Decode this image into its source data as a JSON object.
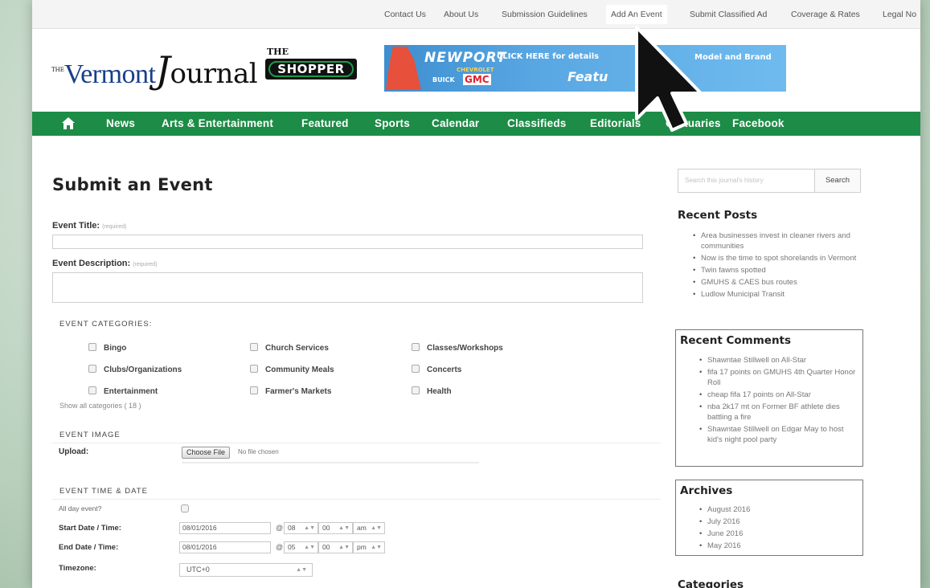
{
  "top_links": [
    "Contact Us",
    "About Us",
    "Submission Guidelines",
    "Add An Event",
    "Submit Classified Ad",
    "Coverage & Rates",
    "Legal No"
  ],
  "logo": {
    "the": "THE",
    "vermont": "Vermont",
    "journal_j": "J",
    "journal_rest": "ournal",
    "shopper_the": "THE",
    "shopper": "SHOPPER"
  },
  "banner": {
    "newport": "NEWPORT",
    "chevrolet": "CHEVROLET",
    "buick": "BUICK",
    "gmc": "GMC",
    "click": "CLICK HERE for details",
    "featured": "Featu",
    "right_text": "Model and Brand"
  },
  "nav": {
    "home_icon": "home-icon",
    "items": [
      "News",
      "Arts & Entertainment",
      "Featured",
      "Sports",
      "Calendar",
      "Classifieds",
      "Editorials",
      "Obituaries",
      "Facebook"
    ]
  },
  "form": {
    "title": "Submit an Event",
    "event_title_label": "Event Title:",
    "event_title_req": "(required)",
    "event_desc_label": "Event Description:",
    "event_desc_req": "(required)",
    "categories_heading": "EVENT CATEGORIES:",
    "categories": [
      "Bingo",
      "Church Services",
      "Classes/Workshops",
      "Clubs/Organizations",
      "Community Meals",
      "Concerts",
      "Entertainment",
      "Farmer's Markets",
      "Health"
    ],
    "show_all": "Show all categories ( 18 )",
    "image_heading": "EVENT IMAGE",
    "upload_label": "Upload:",
    "choose_file": "Choose File",
    "no_file": "No file chosen",
    "time_heading": "EVENT TIME & DATE",
    "all_day_label": "All day event?",
    "start_label": "Start Date / Time:",
    "start_date": "08/01/2016",
    "start_hour": "08",
    "start_min": "00",
    "start_ampm": "am",
    "end_label": "End Date / Time:",
    "end_date": "08/01/2016",
    "end_hour": "05",
    "end_min": "00",
    "end_ampm": "pm",
    "at": "@",
    "timezone_label": "Timezone:",
    "timezone_value": "UTC+0"
  },
  "sidebar": {
    "search_placeholder": "Search this journal's history",
    "search_button": "Search",
    "recent_posts_heading": "Recent Posts",
    "recent_posts": [
      "Area businesses invest in cleaner rivers and communities",
      "Now is the time to spot shorelands in Vermont",
      "Twin fawns spotted",
      "GMUHS & CAES bus routes",
      "Ludlow Municipal Transit"
    ],
    "recent_comments_heading": "Recent Comments",
    "recent_comments": [
      "Shawntae Stillwell on All-Star",
      "fifa 17 points on GMUHS 4th Quarter Honor Roll",
      "cheap fifa 17 points on All-Star",
      "nba 2k17 mt on Former BF athlete dies battling a fire",
      "Shawntae Stillwell on Edgar May to host kid's night pool party"
    ],
    "archives_heading": "Archives",
    "archives": [
      "August 2016",
      "July 2016",
      "June 2016",
      "May 2016"
    ],
    "categories_heading": "Categories"
  }
}
